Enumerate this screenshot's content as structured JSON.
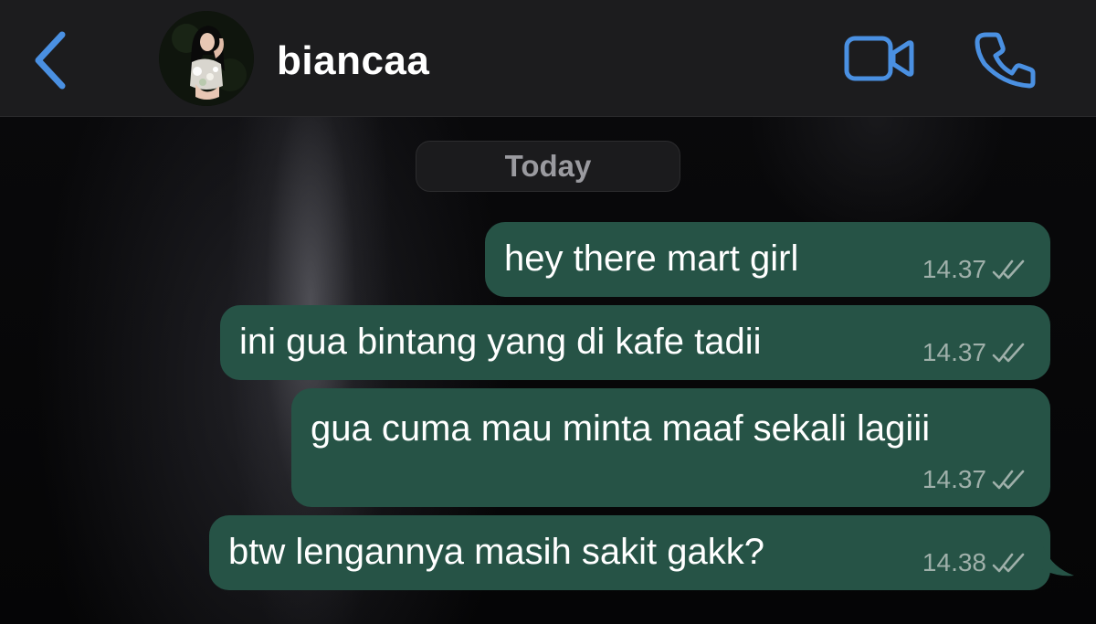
{
  "header": {
    "contact_name": "biancaa"
  },
  "date_separator": "Today",
  "messages": [
    {
      "text": "hey there mart girl",
      "time": "14.37",
      "status": "read-double-check-icon"
    },
    {
      "text": "ini gua bintang yang di kafe tadii",
      "time": "14.37",
      "status": "read-double-check-icon"
    },
    {
      "text": "gua cuma mau minta maaf sekali lagiii",
      "time": "14.37",
      "status": "read-double-check-icon"
    },
    {
      "text": "btw lengannya masih sakit gakk?",
      "time": "14.38",
      "status": "read-double-check-icon"
    }
  ],
  "colors": {
    "accent": "#4a90e2",
    "header_bg": "#1c1c1e",
    "bubble_outgoing": "#265346",
    "timestamp": "#9fb0aa"
  },
  "icons": {
    "back": "chevron-left-icon",
    "video": "video-camera-icon",
    "call": "phone-icon"
  }
}
